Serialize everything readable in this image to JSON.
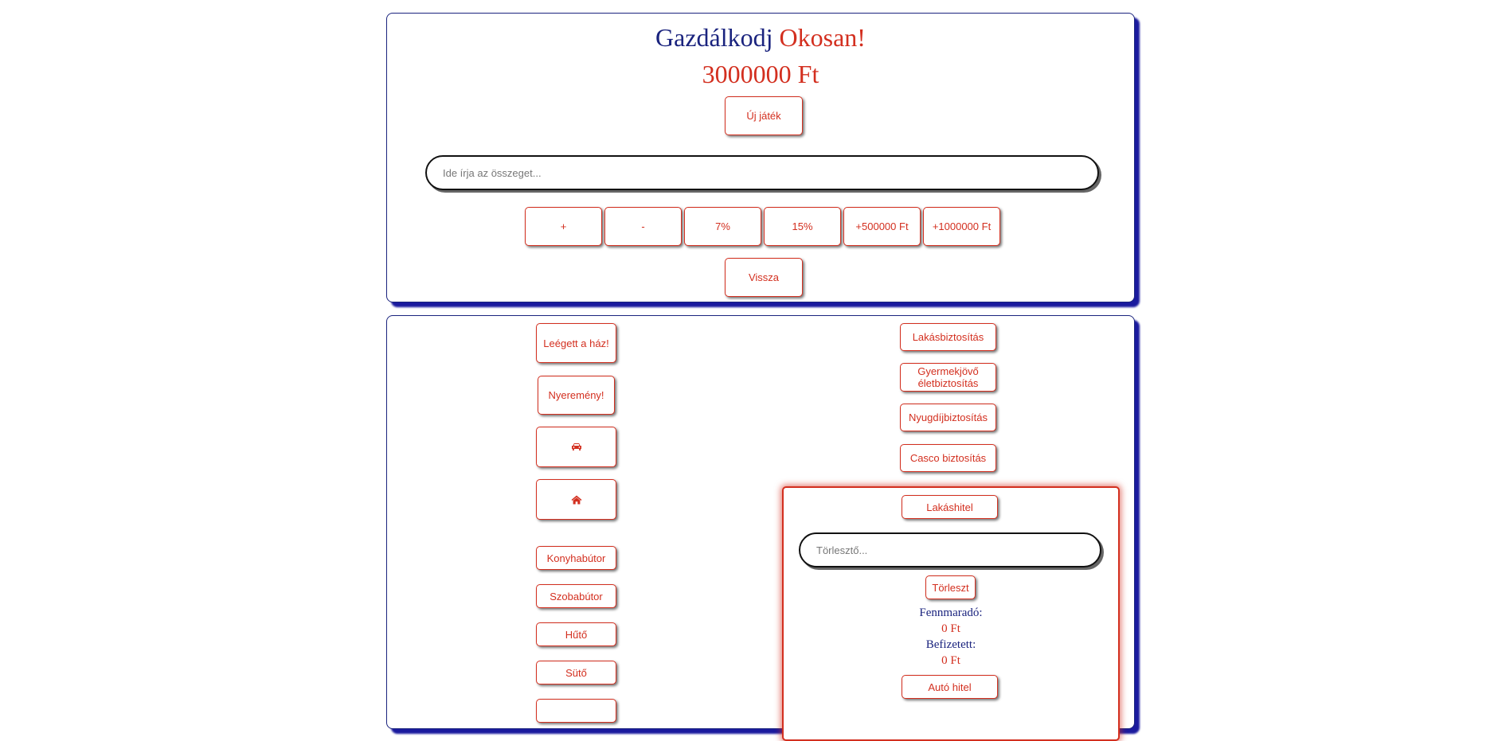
{
  "header": {
    "title_part1": "Gazdálkodj",
    "title_part2": "Okosan!",
    "balance": "3000000 Ft",
    "new_game_label": "Új játék"
  },
  "amount_input": {
    "placeholder": "Ide írja az összeget...",
    "value": ""
  },
  "operations": {
    "plus": "+",
    "minus": "-",
    "pct7": "7%",
    "pct15": "15%",
    "add500k": "+500000 Ft",
    "add1m": "+1000000 Ft",
    "back": "Vissza"
  },
  "events": {
    "house_burned": "Leégett a ház!",
    "prize": "Nyeremény!",
    "car_icon": "car-icon",
    "home_icon": "home-icon"
  },
  "furniture": {
    "kitchen": "Konyhabútor",
    "room": "Szobabútor",
    "fridge": "Hűtő",
    "oven": "Sütő"
  },
  "insurance": {
    "home": "Lakásbiztosítás",
    "child_life_line1": "Gyermekjövő",
    "child_life_line2": "életbiztosítás",
    "pension": "Nyugdíjbiztosítás",
    "casco": "Casco biztosítás"
  },
  "home_loan": {
    "label": "Lakáshitel",
    "input_placeholder": "Törlesztő...",
    "input_value": "",
    "repay_label": "Törleszt",
    "remaining_label": "Fennmaradó:",
    "remaining_value": "0 Ft",
    "paid_label": "Befizetett:",
    "paid_value": "0 Ft"
  },
  "car_loan": {
    "label": "Autó hitel"
  },
  "colors": {
    "navy": "#1a237e",
    "red": "#d32f1f"
  }
}
